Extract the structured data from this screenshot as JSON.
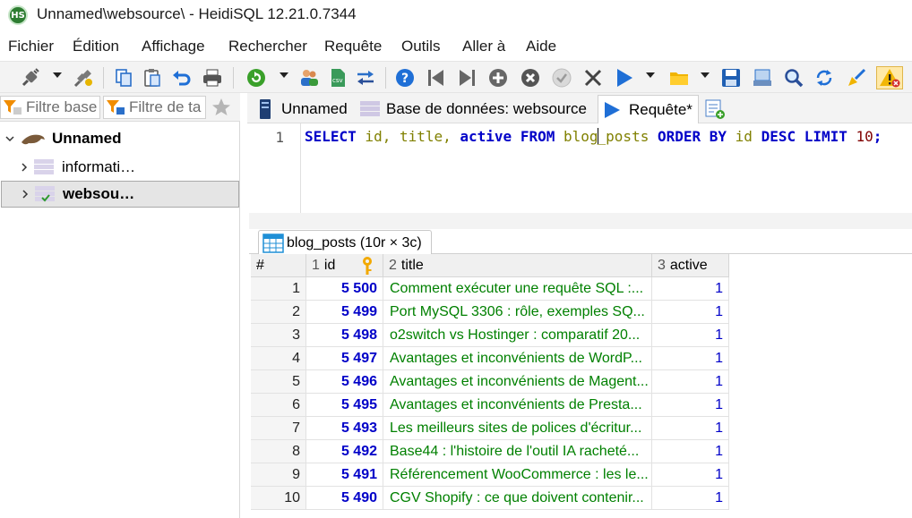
{
  "window": {
    "title": "Unnamed\\websource\\ - HeidiSQL 12.21.0.7344",
    "icon_text": "HS"
  },
  "menu": [
    "Fichier",
    "Édition",
    "Affichage",
    "Rechercher",
    "Requête",
    "Outils",
    "Aller à",
    "Aide"
  ],
  "toolbar": {
    "icons": [
      "connect-icon",
      "disconnect-icon",
      "copy-icon",
      "paste-icon",
      "undo-icon",
      "print-icon",
      "refresh-icon",
      "user-manager-icon",
      "export-csv-icon",
      "data-transfer-icon",
      "help-icon",
      "first-record-icon",
      "last-record-icon",
      "insert-record-icon",
      "delete-record-icon",
      "post-record-icon",
      "cancel-record-icon",
      "execute-icon",
      "open-file-icon",
      "save-icon",
      "save-snippet-icon",
      "find-icon",
      "replace-icon",
      "clear-icon",
      "warning-icon"
    ]
  },
  "left_panel": {
    "filter_database_placeholder": "Filtre base",
    "filter_table_placeholder": "Filtre de ta",
    "tree": {
      "root_label": "Unnamed",
      "items": [
        {
          "label": "informati…",
          "selected": false
        },
        {
          "label": "websou…",
          "selected": true
        }
      ]
    }
  },
  "tabs": [
    {
      "label": "Unnamed",
      "icon": "server-icon",
      "active": false
    },
    {
      "label": "Base de données: websource",
      "icon": "database-icon",
      "active": false
    },
    {
      "label": "Requête*",
      "icon": "query-play-icon",
      "active": true
    }
  ],
  "editor": {
    "line_number": "1",
    "tokens": [
      {
        "t": "SELECT",
        "c": "kw"
      },
      {
        "t": " id, title, ",
        "c": "fld"
      },
      {
        "t": "active",
        "c": "kw"
      },
      {
        "t": " ",
        "c": ""
      },
      {
        "t": "FROM",
        "c": "kw"
      },
      {
        "t": " blog",
        "c": "fld"
      },
      {
        "t": "_posts",
        "c": "fld"
      },
      {
        "t": " ",
        "c": ""
      },
      {
        "t": "ORDER BY",
        "c": "kw"
      },
      {
        "t": " id ",
        "c": "fld"
      },
      {
        "t": "DESC LIMIT",
        "c": "kw"
      },
      {
        "t": " ",
        "c": ""
      },
      {
        "t": "10",
        "c": "num"
      },
      {
        "t": ";",
        "c": "kw"
      }
    ]
  },
  "result": {
    "tab_label": "blog_posts (10r × 3c)",
    "columns": [
      {
        "num": "",
        "name": "#"
      },
      {
        "num": "1",
        "name": "id"
      },
      {
        "num": "2",
        "name": "title"
      },
      {
        "num": "3",
        "name": "active"
      }
    ],
    "rows": [
      {
        "rn": "1",
        "id": "5 500",
        "title": "Comment exécuter une requête SQL :...",
        "active": "1"
      },
      {
        "rn": "2",
        "id": "5 499",
        "title": "Port MySQL 3306 : rôle, exemples SQ...",
        "active": "1"
      },
      {
        "rn": "3",
        "id": "5 498",
        "title": "o2switch vs Hostinger : comparatif 20...",
        "active": "1"
      },
      {
        "rn": "4",
        "id": "5 497",
        "title": "Avantages et inconvénients de WordP...",
        "active": "1"
      },
      {
        "rn": "5",
        "id": "5 496",
        "title": "Avantages et inconvénients de Magent...",
        "active": "1"
      },
      {
        "rn": "6",
        "id": "5 495",
        "title": "Avantages et inconvénients de Presta...",
        "active": "1"
      },
      {
        "rn": "7",
        "id": "5 493",
        "title": "Les meilleurs sites de polices d'écritur...",
        "active": "1"
      },
      {
        "rn": "8",
        "id": "5 492",
        "title": "Base44 : l'histoire de l'outil IA racheté...",
        "active": "1"
      },
      {
        "rn": "9",
        "id": "5 491",
        "title": "Référencement WooCommerce : les le...",
        "active": "1"
      },
      {
        "rn": "10",
        "id": "5 490",
        "title": "CGV Shopify : ce que doivent contenir...",
        "active": "1"
      }
    ]
  },
  "colors": {
    "keyword": "#0000c8",
    "identifier": "#808000",
    "number": "#800000",
    "title_text": "#008000",
    "id_text": "#0000c8"
  }
}
